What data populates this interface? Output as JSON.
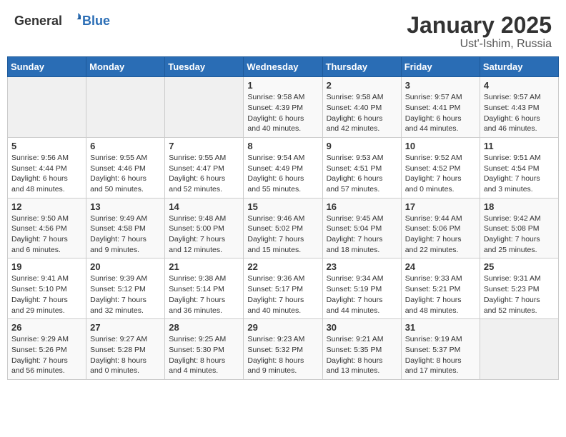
{
  "header": {
    "logo_general": "General",
    "logo_blue": "Blue",
    "title": "January 2025",
    "subtitle": "Ust'-Ishim, Russia"
  },
  "days_of_week": [
    "Sunday",
    "Monday",
    "Tuesday",
    "Wednesday",
    "Thursday",
    "Friday",
    "Saturday"
  ],
  "weeks": [
    [
      null,
      null,
      null,
      {
        "day": "1",
        "sunrise": "Sunrise: 9:58 AM",
        "sunset": "Sunset: 4:39 PM",
        "daylight": "Daylight: 6 hours and 40 minutes."
      },
      {
        "day": "2",
        "sunrise": "Sunrise: 9:58 AM",
        "sunset": "Sunset: 4:40 PM",
        "daylight": "Daylight: 6 hours and 42 minutes."
      },
      {
        "day": "3",
        "sunrise": "Sunrise: 9:57 AM",
        "sunset": "Sunset: 4:41 PM",
        "daylight": "Daylight: 6 hours and 44 minutes."
      },
      {
        "day": "4",
        "sunrise": "Sunrise: 9:57 AM",
        "sunset": "Sunset: 4:43 PM",
        "daylight": "Daylight: 6 hours and 46 minutes."
      }
    ],
    [
      {
        "day": "5",
        "sunrise": "Sunrise: 9:56 AM",
        "sunset": "Sunset: 4:44 PM",
        "daylight": "Daylight: 6 hours and 48 minutes."
      },
      {
        "day": "6",
        "sunrise": "Sunrise: 9:55 AM",
        "sunset": "Sunset: 4:46 PM",
        "daylight": "Daylight: 6 hours and 50 minutes."
      },
      {
        "day": "7",
        "sunrise": "Sunrise: 9:55 AM",
        "sunset": "Sunset: 4:47 PM",
        "daylight": "Daylight: 6 hours and 52 minutes."
      },
      {
        "day": "8",
        "sunrise": "Sunrise: 9:54 AM",
        "sunset": "Sunset: 4:49 PM",
        "daylight": "Daylight: 6 hours and 55 minutes."
      },
      {
        "day": "9",
        "sunrise": "Sunrise: 9:53 AM",
        "sunset": "Sunset: 4:51 PM",
        "daylight": "Daylight: 6 hours and 57 minutes."
      },
      {
        "day": "10",
        "sunrise": "Sunrise: 9:52 AM",
        "sunset": "Sunset: 4:52 PM",
        "daylight": "Daylight: 7 hours and 0 minutes."
      },
      {
        "day": "11",
        "sunrise": "Sunrise: 9:51 AM",
        "sunset": "Sunset: 4:54 PM",
        "daylight": "Daylight: 7 hours and 3 minutes."
      }
    ],
    [
      {
        "day": "12",
        "sunrise": "Sunrise: 9:50 AM",
        "sunset": "Sunset: 4:56 PM",
        "daylight": "Daylight: 7 hours and 6 minutes."
      },
      {
        "day": "13",
        "sunrise": "Sunrise: 9:49 AM",
        "sunset": "Sunset: 4:58 PM",
        "daylight": "Daylight: 7 hours and 9 minutes."
      },
      {
        "day": "14",
        "sunrise": "Sunrise: 9:48 AM",
        "sunset": "Sunset: 5:00 PM",
        "daylight": "Daylight: 7 hours and 12 minutes."
      },
      {
        "day": "15",
        "sunrise": "Sunrise: 9:46 AM",
        "sunset": "Sunset: 5:02 PM",
        "daylight": "Daylight: 7 hours and 15 minutes."
      },
      {
        "day": "16",
        "sunrise": "Sunrise: 9:45 AM",
        "sunset": "Sunset: 5:04 PM",
        "daylight": "Daylight: 7 hours and 18 minutes."
      },
      {
        "day": "17",
        "sunrise": "Sunrise: 9:44 AM",
        "sunset": "Sunset: 5:06 PM",
        "daylight": "Daylight: 7 hours and 22 minutes."
      },
      {
        "day": "18",
        "sunrise": "Sunrise: 9:42 AM",
        "sunset": "Sunset: 5:08 PM",
        "daylight": "Daylight: 7 hours and 25 minutes."
      }
    ],
    [
      {
        "day": "19",
        "sunrise": "Sunrise: 9:41 AM",
        "sunset": "Sunset: 5:10 PM",
        "daylight": "Daylight: 7 hours and 29 minutes."
      },
      {
        "day": "20",
        "sunrise": "Sunrise: 9:39 AM",
        "sunset": "Sunset: 5:12 PM",
        "daylight": "Daylight: 7 hours and 32 minutes."
      },
      {
        "day": "21",
        "sunrise": "Sunrise: 9:38 AM",
        "sunset": "Sunset: 5:14 PM",
        "daylight": "Daylight: 7 hours and 36 minutes."
      },
      {
        "day": "22",
        "sunrise": "Sunrise: 9:36 AM",
        "sunset": "Sunset: 5:17 PM",
        "daylight": "Daylight: 7 hours and 40 minutes."
      },
      {
        "day": "23",
        "sunrise": "Sunrise: 9:34 AM",
        "sunset": "Sunset: 5:19 PM",
        "daylight": "Daylight: 7 hours and 44 minutes."
      },
      {
        "day": "24",
        "sunrise": "Sunrise: 9:33 AM",
        "sunset": "Sunset: 5:21 PM",
        "daylight": "Daylight: 7 hours and 48 minutes."
      },
      {
        "day": "25",
        "sunrise": "Sunrise: 9:31 AM",
        "sunset": "Sunset: 5:23 PM",
        "daylight": "Daylight: 7 hours and 52 minutes."
      }
    ],
    [
      {
        "day": "26",
        "sunrise": "Sunrise: 9:29 AM",
        "sunset": "Sunset: 5:26 PM",
        "daylight": "Daylight: 7 hours and 56 minutes."
      },
      {
        "day": "27",
        "sunrise": "Sunrise: 9:27 AM",
        "sunset": "Sunset: 5:28 PM",
        "daylight": "Daylight: 8 hours and 0 minutes."
      },
      {
        "day": "28",
        "sunrise": "Sunrise: 9:25 AM",
        "sunset": "Sunset: 5:30 PM",
        "daylight": "Daylight: 8 hours and 4 minutes."
      },
      {
        "day": "29",
        "sunrise": "Sunrise: 9:23 AM",
        "sunset": "Sunset: 5:32 PM",
        "daylight": "Daylight: 8 hours and 9 minutes."
      },
      {
        "day": "30",
        "sunrise": "Sunrise: 9:21 AM",
        "sunset": "Sunset: 5:35 PM",
        "daylight": "Daylight: 8 hours and 13 minutes."
      },
      {
        "day": "31",
        "sunrise": "Sunrise: 9:19 AM",
        "sunset": "Sunset: 5:37 PM",
        "daylight": "Daylight: 8 hours and 17 minutes."
      },
      null
    ]
  ]
}
